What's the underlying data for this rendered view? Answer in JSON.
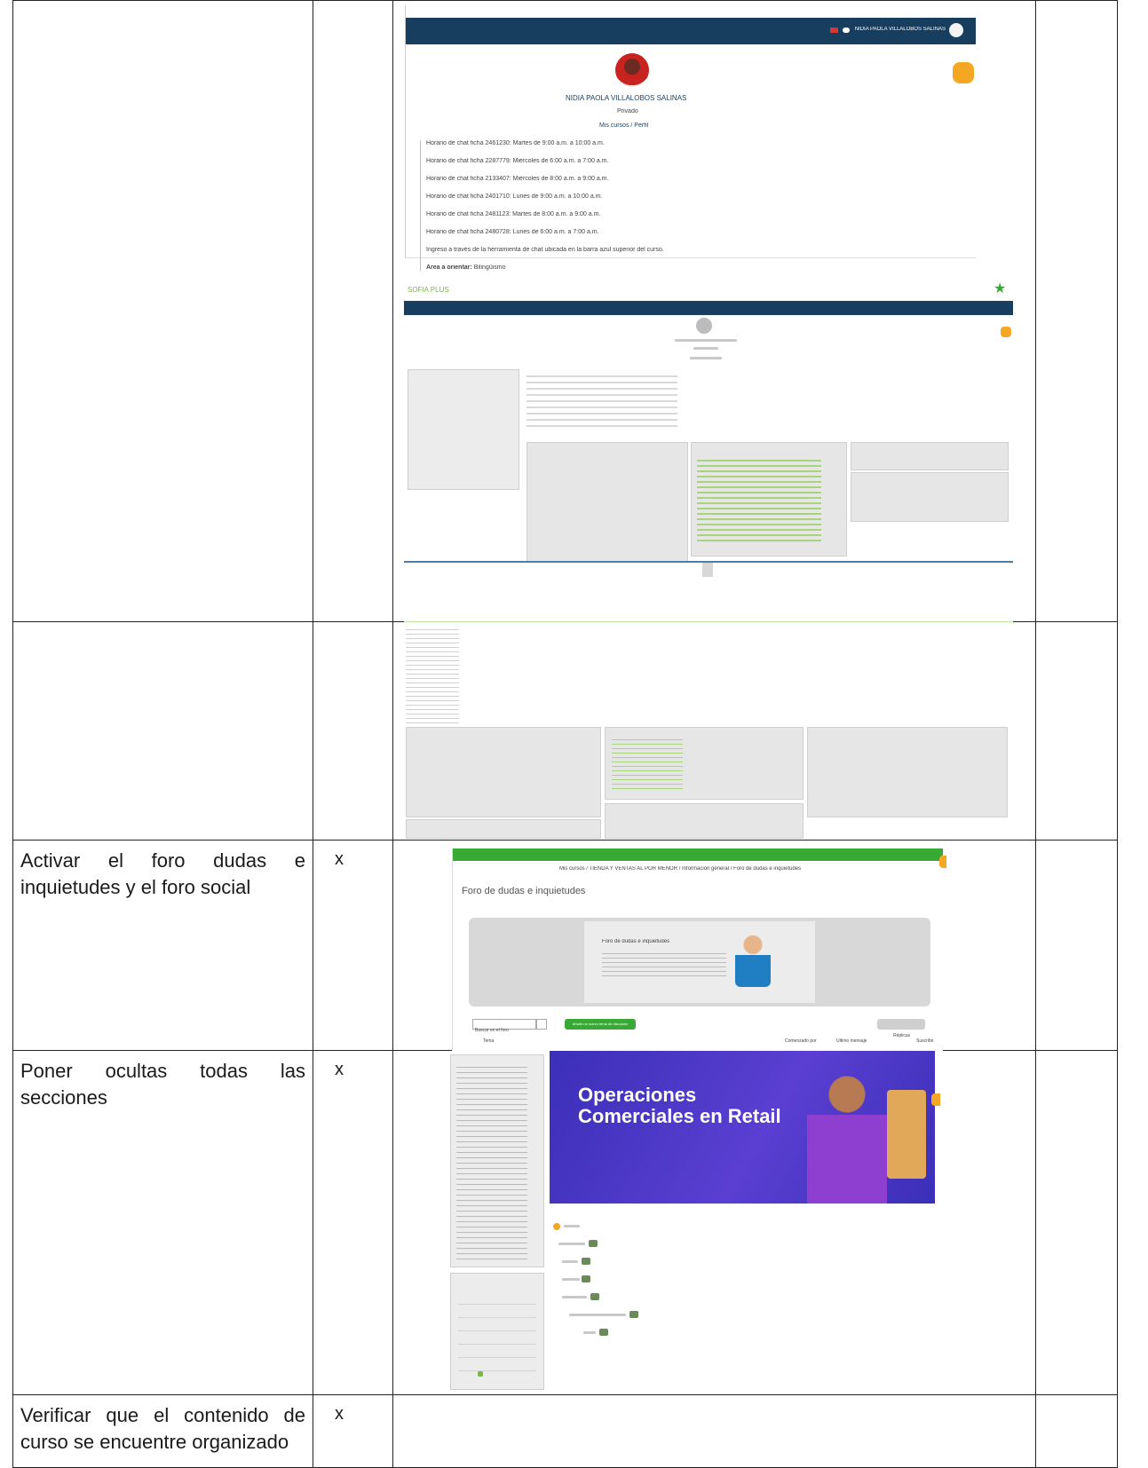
{
  "rows": [
    {
      "task": "",
      "mark": "",
      "shot": {
        "profile_top": {
          "user_name": "NIDIA PAOLA VILLALOBOS SALINAS",
          "status": "Privado",
          "breadcrumb": "Mis cursos / Perfil",
          "schedule_lines": [
            "Horario de chat ficha 2461230: Martes de 9:00 a.m. a 10:00 a.m.",
            "Horario de chat ficha 2287779: Miércoles de 6:00 a.m. a 7:00 a.m.",
            "Horario de chat ficha 2133407: Miércoles de 8:00 a.m. a 9:00 a.m.",
            "Horario de chat ficha 2401710: Lunes de 9:00 a.m. a 10:00 a.m.",
            "Horario de chat ficha 2481123: Martes de 8:00 a.m. a 9:00 a.m.",
            "Horario de chat ficha 2480728: Lunes de 6:00 a.m. a 7:00 a.m.",
            "Ingreso a través de la herramienta de chat ubicada en la barra azul superior del curso."
          ],
          "area_label": "Área a orientar:",
          "area_value": "Bilingüismo"
        },
        "profile_full": {
          "brand": "SOFIA PLUS"
        }
      }
    },
    {
      "task": "Activar el foro dudas e inquietudes y el foro social",
      "mark": "x",
      "shot": {
        "breadcrumb": "Mis cursos / TIENDA Y VENTAS AL POR MENOR / Información general / Foro de dudas e inquietudes",
        "title": "Foro de dudas e inquietudes",
        "banner_title": "Foro de dudas e inquietudes",
        "search_placeholder": "Buscar en el foro",
        "add_button": "Añadir un nuevo tema de discusión",
        "col_tema": "Tema",
        "col_comenzado": "Comenzado por",
        "col_ultimo": "Último mensaje",
        "col_replicas": "Réplicas",
        "col_suscribir": "Suscribir"
      }
    },
    {
      "task": "Poner ocultas todas las secciones",
      "mark": "x",
      "shot": {
        "banner_line1": "Operaciones",
        "banner_line2": "Comerciales en Retail"
      }
    },
    {
      "task": "Verificar que el contenido de curso se encuentre organizado",
      "mark": "x",
      "shot": {}
    }
  ]
}
